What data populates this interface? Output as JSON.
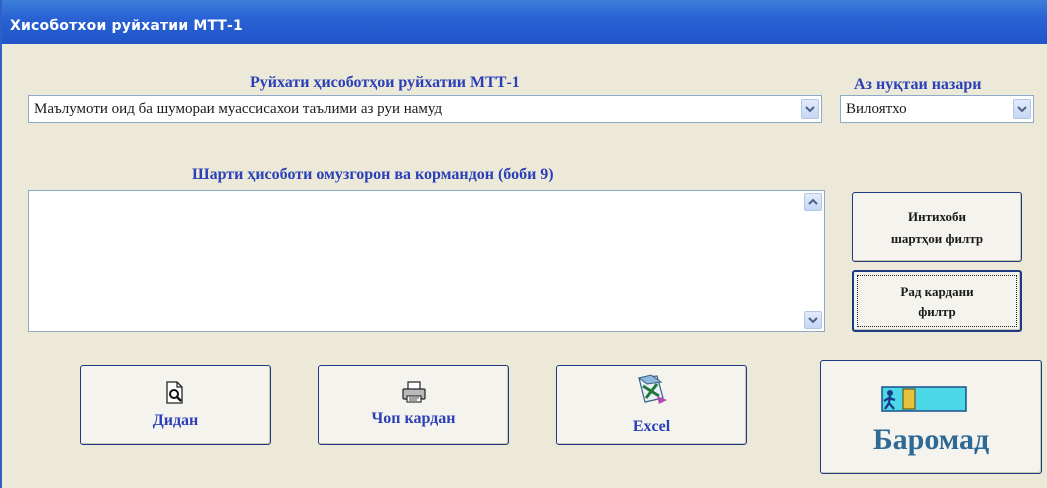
{
  "window": {
    "title": "Хисоботхои руйхатии МТТ-1"
  },
  "report_list": {
    "label": "Руйхати ҳисоботҳои руйхатии МТТ-1",
    "selected": "Маълумоти оид ба шумораи муассисахои таълими аз руи намуд"
  },
  "viewpoint": {
    "label": "Аз нуқтаи назари",
    "selected": "Вилоятхо"
  },
  "condition": {
    "label": "Шарти ҳисоботи омузгорон ва кормандон (боби 9)",
    "text": ""
  },
  "filter": {
    "select_line1": "Интихоби",
    "select_line2": "шартҳои филтр",
    "cancel_line1": "Рад кардани",
    "cancel_line2": "филтр"
  },
  "actions": {
    "view": "Дидан",
    "print": "Чоп кардан",
    "excel": "Excel",
    "exit": "Баромад"
  },
  "colors": {
    "label": "#2a3fb8",
    "title_bar": "#2a62d4",
    "exit_label": "#2f6a96"
  },
  "icons": {
    "view": "magnifier-page-icon",
    "print": "printer-icon",
    "excel": "excel-icon",
    "exit": "exit-door-icon"
  }
}
